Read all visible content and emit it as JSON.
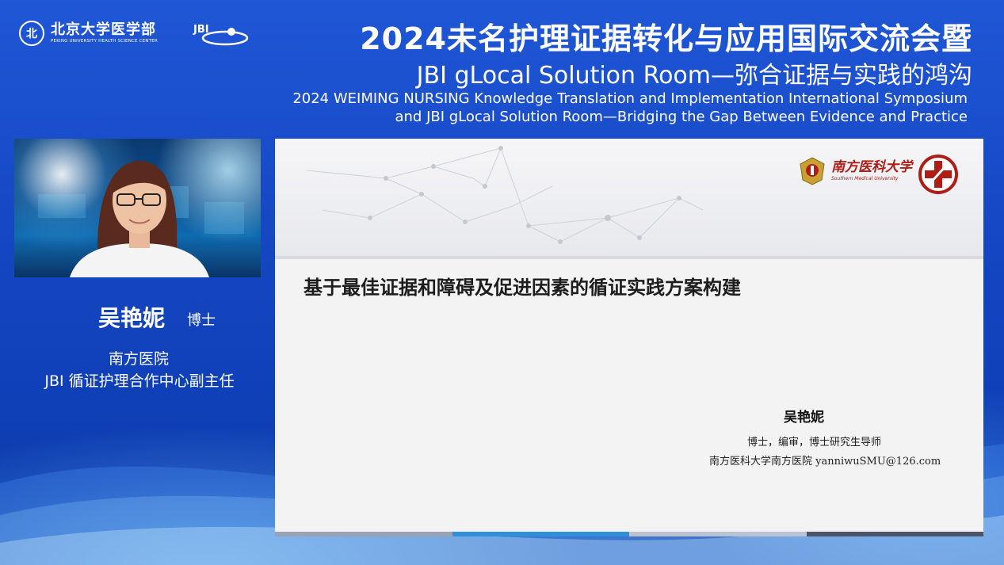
{
  "header": {
    "logo_pku_cn": "北京大学医学部",
    "logo_pku_en": "PEKING UNIVERSITY HEALTH SCIENCE CENTER",
    "logo_jbi": "JBI",
    "title_cn": "2024未名护理证据转化与应用国际交流会暨",
    "title_sub": "JBI gLocal Solution Room—弥合证据与实践的鸿沟",
    "title_en_line1": "2024 WEIMING NURSING Knowledge Translation and Implementation International Symposium",
    "title_en_line2": "and JBI gLocal Solution Room—Bridging the Gap Between Evidence and Practice"
  },
  "speaker": {
    "name": "吴艳妮",
    "degree": "博士",
    "organization": "南方医院",
    "role": "JBI 循证护理合作中心副主任"
  },
  "slide": {
    "logo_smu_cn": "南方医科大学",
    "logo_smu_en": "Southern Medical University",
    "title": "基于最佳证据和障碍及促进因素的循证实践方案构建",
    "author_name": "吴艳妮",
    "author_desc": "博士，编审，博士研究生导师",
    "author_affiliation": "南方医科大学南方医院  yanniwuSMU@126.com"
  },
  "colors": {
    "background": "#1647c4",
    "accent_red": "#b01d16",
    "slide_bg": "#f3f3f4"
  }
}
